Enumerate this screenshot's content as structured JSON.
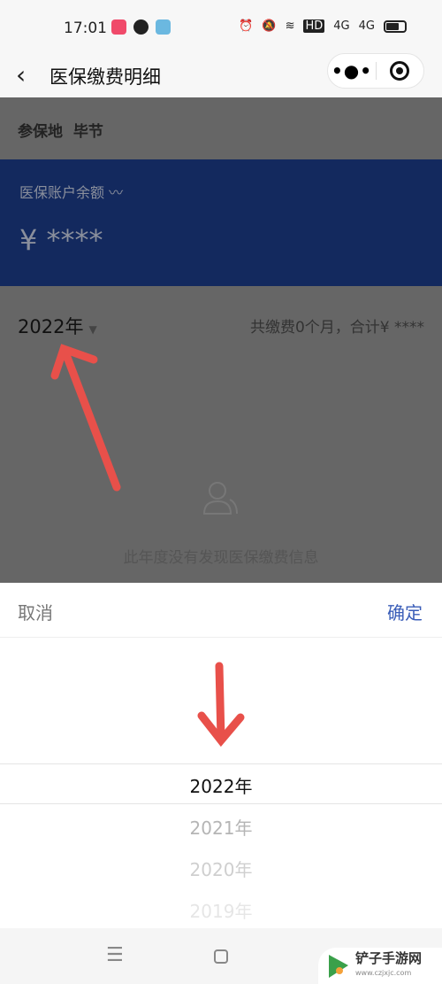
{
  "status_bar": {
    "time": "17:01",
    "icons": [
      "video-app-icon",
      "wechat-icon",
      "app-icon",
      "alarm-icon",
      "mute-icon",
      "wifi-icon",
      "hd-icon",
      "4g-signal-icon",
      "4g-signal-icon",
      "battery-icon"
    ],
    "hd": "HD",
    "net1": "4G",
    "net2": "4G"
  },
  "nav": {
    "title": "医保缴费明细",
    "more": "•●•"
  },
  "location": {
    "label": "参保地",
    "value": "毕节"
  },
  "account": {
    "label": "医保账户余额",
    "amount": "¥ ****"
  },
  "year_filter": {
    "year": "2022年",
    "summary": "共缴费0个月，合计¥ ****"
  },
  "empty_text": "此年度没有发现医保缴费信息",
  "picker": {
    "cancel": "取消",
    "confirm": "确定",
    "options": [
      "2022年",
      "2021年",
      "2020年",
      "2019年"
    ],
    "selected": "2022年"
  },
  "watermark": {
    "name": "铲子手游网",
    "url": "www.czjxjc.com"
  },
  "colors": {
    "accent": "#3a5db8",
    "annotation": "#e8504a",
    "account_bg": "#13295e"
  }
}
